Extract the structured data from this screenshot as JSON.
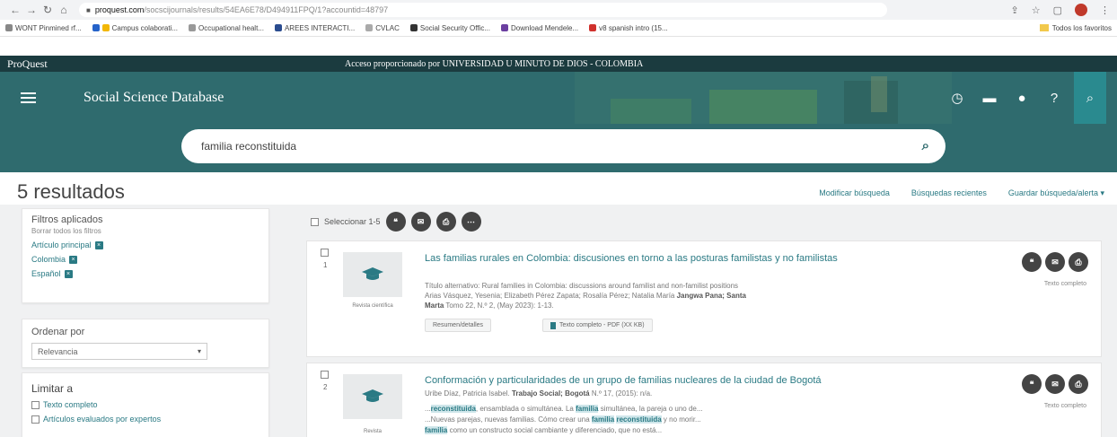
{
  "browser": {
    "url_host": "proquest.com",
    "url_path": "/socscijournals/results/54EA6E78/D494911FPQ/1?accountid=48797",
    "bookmarks": [
      "WONT Pinmined rf...",
      "Campus colaborati...",
      "Occupational healt...",
      "AREES INTERACTI...",
      "CVLAC",
      "Social Security Offic...",
      "Download Mendele...",
      "v8 spanish intro (15..."
    ],
    "bookmarks_right": "Todos los favoritos"
  },
  "pq": {
    "brand": "ProQuest",
    "access_text": "Acceso proporcionado por UNIVERSIDAD U MINUTO DE DIOS - COLOMBIA",
    "db_title": "Social Science Database",
    "search_value": "familia reconstituida"
  },
  "results": {
    "count_label": "5 resultados",
    "actions": [
      "Modificar búsqueda",
      "Búsquedas recientes",
      "Guardar búsqueda/alerta ▾"
    ],
    "select_label": "Seleccionar 1-5"
  },
  "sidebar": {
    "filters_title": "Filtros aplicados",
    "clear_all": "Borrar todos los filtros",
    "filters": [
      "Artículo principal",
      "Colombia",
      "Español"
    ],
    "sort_title": "Ordenar por",
    "sort_value": "Relevancia",
    "limit_title": "Limitar a",
    "limit_options": [
      "Texto completo",
      "Artículos evaluados por expertos"
    ]
  },
  "items": [
    {
      "num": "1",
      "doc_type": "Revista científica",
      "title": "Las familias rurales en Colombia: discusiones en torno a las posturas familistas y no familistas",
      "meta1": "Título alternativo: Rural families in Colombia: discussions around familist and non-familist positions",
      "meta2": "Arias Vásquez, Yesenia; Elizabeth Pérez Zapata; Rosalía Pérez; Natalia María",
      "meta2_bold": "Jangwa Pana; Santa",
      "meta3_bold": "Marta",
      "meta3": "Tomo 22, N.º 2, (May 2023): 1-13.",
      "pill1": "Resumen/detalles",
      "pill2": "Texto completo - PDF (XX KB)",
      "fulltext": "Texto completo"
    },
    {
      "num": "2",
      "doc_type": "Revista",
      "title": "Conformación y particularidades de un grupo de familias nucleares de la ciudad de Bogotá",
      "meta2": "Uribe Díaz, Patricia Isabel.",
      "meta2_bold": "Trabajo Social; Bogotá",
      "meta2_tail": "N.º 17, (2015): n/a.",
      "snip1_a": "...",
      "snip1_hl": "reconstituida",
      "snip1_b": ", ensamblada o simultánea. La",
      "snip1_hl2": "familia",
      "snip1_c": "simultánea, la pareja o uno de...",
      "snip2_a": "...Nuevas parejas, nuevas familias. Cómo crear una",
      "snip2_hl": "familia",
      "snip2_hl2": "reconstituida",
      "snip2_b": "y no morir...",
      "snip3_hl": "familia",
      "snip3_b": "como un constructo social cambiante y diferenciado, que no está...",
      "fulltext": "Texto completo"
    }
  ],
  "colors": {
    "teal_dark": "#1b3b3f",
    "teal": "#2f6b6e",
    "link": "#2a7a84"
  }
}
